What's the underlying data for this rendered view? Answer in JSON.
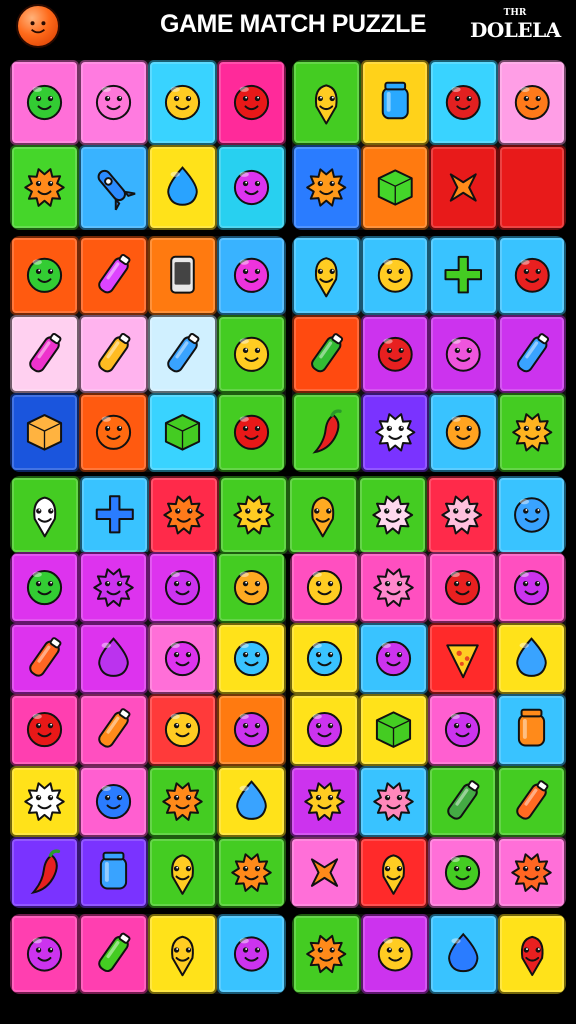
{
  "header": {
    "title": "GAME MATCH PUZZLE",
    "brand_small": "THR",
    "brand_large": "DOLELA",
    "menu_icon": "orange-face-icon"
  },
  "panels": [
    {
      "name": "left-block-1",
      "cols": 4,
      "rows": 2,
      "tiles": [
        {
          "bg": "#ff6fd8",
          "icon": "blob-face",
          "color": "#33cc33"
        },
        {
          "bg": "#ff7be0",
          "icon": "blob-face",
          "color": "#ff77d9"
        },
        {
          "bg": "#39d3ff",
          "icon": "blob-face",
          "color": "#ffcc22"
        },
        {
          "bg": "#ff2a9a",
          "icon": "blob-face",
          "color": "#e81818"
        },
        {
          "bg": "#45d62a",
          "icon": "spiky-face",
          "color": "#ff8a1a"
        },
        {
          "bg": "#39b3ff",
          "icon": "rocket",
          "color": "#2b8bff"
        },
        {
          "bg": "#ffe21a",
          "icon": "drop",
          "color": "#29a3ff"
        },
        {
          "bg": "#28d0f0",
          "icon": "blob-face",
          "color": "#dd33ee"
        }
      ]
    },
    {
      "name": "right-block-1",
      "cols": 4,
      "rows": 2,
      "tiles": [
        {
          "bg": "#44cc22",
          "icon": "cone-face",
          "color": "#ffcc22"
        },
        {
          "bg": "#ffd21a",
          "icon": "jar",
          "color": "#2aa9ff"
        },
        {
          "bg": "#39d3ff",
          "icon": "blob-face",
          "color": "#e32020"
        },
        {
          "bg": "#ff9ee6",
          "icon": "blob-face",
          "color": "#ff7a1a"
        },
        {
          "bg": "#2a7cff",
          "icon": "spiky-face",
          "color": "#ff9a1a"
        },
        {
          "bg": "#ff7a10",
          "icon": "cube",
          "color": "#44d62a"
        },
        {
          "bg": "#e81a1a",
          "icon": "cross",
          "color": "#ff8c1a"
        },
        {
          "bg": "#e81a1a",
          "icon": "none",
          "color": "#ff8c1a"
        }
      ]
    },
    {
      "name": "left-block-2",
      "cols": 4,
      "rows": 3,
      "tiles": [
        {
          "bg": "#ff5a10",
          "icon": "blob-face",
          "color": "#33cc33"
        },
        {
          "bg": "#ff5a10",
          "icon": "bottle",
          "color": "#dd44ff"
        },
        {
          "bg": "#ff7a10",
          "icon": "phone",
          "color": "#444444"
        },
        {
          "bg": "#39b3ff",
          "icon": "blob-face",
          "color": "#ee33dd"
        },
        {
          "bg": "#ffd0f0",
          "icon": "bottle",
          "color": "#ee33cc"
        },
        {
          "bg": "#ffb3ee",
          "icon": "bottle",
          "color": "#ffbb22"
        },
        {
          "bg": "#d0f0ff",
          "icon": "bottle",
          "color": "#39a3ff"
        },
        {
          "bg": "#44cc22",
          "icon": "blob-face",
          "color": "#ffcc22"
        },
        {
          "bg": "#1a55dd",
          "icon": "cube",
          "color": "#ffb340"
        },
        {
          "bg": "#ff5a10",
          "icon": "blob-face",
          "color": "#ff6a10"
        },
        {
          "bg": "#39d3ff",
          "icon": "cube",
          "color": "#44cc22"
        },
        {
          "bg": "#44cc22",
          "icon": "blob-face",
          "color": "#e81818"
        }
      ]
    },
    {
      "name": "right-block-2",
      "cols": 4,
      "rows": 3,
      "tiles": [
        {
          "bg": "#39c3ff",
          "icon": "cone-face",
          "color": "#ffcc22"
        },
        {
          "bg": "#39c3ff",
          "icon": "blob-face",
          "color": "#ffcc22"
        },
        {
          "bg": "#39c3ff",
          "icon": "plus",
          "color": "#44cc22"
        },
        {
          "bg": "#39c3ff",
          "icon": "blob-face",
          "color": "#e82020"
        },
        {
          "bg": "#ff4a10",
          "icon": "bottle",
          "color": "#33bb33"
        },
        {
          "bg": "#cc33ee",
          "icon": "blob-face",
          "color": "#e82020"
        },
        {
          "bg": "#cc33ee",
          "icon": "blob-face",
          "color": "#ee55dd"
        },
        {
          "bg": "#cc33ee",
          "icon": "bottle",
          "color": "#39a3ff"
        },
        {
          "bg": "#44cc22",
          "icon": "pepper",
          "color": "#e82020"
        },
        {
          "bg": "#7a33ff",
          "icon": "spiky-face",
          "color": "#ffffff"
        },
        {
          "bg": "#39c3ff",
          "icon": "blob-face",
          "color": "#ffa320"
        },
        {
          "bg": "#44cc22",
          "icon": "spiky-face",
          "color": "#ffb320"
        }
      ]
    },
    {
      "name": "middle-row",
      "cols": 8,
      "rows": 1,
      "tiles": [
        {
          "bg": "#44cc22",
          "icon": "cone-face",
          "color": "#ffffff"
        },
        {
          "bg": "#39c3ff",
          "icon": "plus",
          "color": "#2a7cff"
        },
        {
          "bg": "#ff2a4a",
          "icon": "spiky-face",
          "color": "#ff7a1a"
        },
        {
          "bg": "#44cc22",
          "icon": "spiky-face",
          "color": "#ffcc22"
        },
        {
          "bg": "#44cc22",
          "icon": "cone-face",
          "color": "#ffaa22"
        },
        {
          "bg": "#44cc22",
          "icon": "spiky-face",
          "color": "#ffd8ee"
        },
        {
          "bg": "#ff2a4a",
          "icon": "spiky-face",
          "color": "#ffc0dd"
        },
        {
          "bg": "#39c3ff",
          "icon": "blob-face",
          "color": "#39a3ff"
        }
      ]
    },
    {
      "name": "left-block-3",
      "cols": 4,
      "rows": 5,
      "tiles": [
        {
          "bg": "#dd33ee",
          "icon": "blob-face",
          "color": "#33cc33"
        },
        {
          "bg": "#dd33ee",
          "icon": "spiky-face",
          "color": "#cc33ee"
        },
        {
          "bg": "#dd33ee",
          "icon": "blob-face",
          "color": "#cc33ee"
        },
        {
          "bg": "#44cc22",
          "icon": "blob-face",
          "color": "#ffaa22"
        },
        {
          "bg": "#dd33ee",
          "icon": "bottle",
          "color": "#ff6622"
        },
        {
          "bg": "#dd33ee",
          "icon": "drop",
          "color": "#bb33ee"
        },
        {
          "bg": "#ff6fd8",
          "icon": "blob-face",
          "color": "#dd33ee"
        },
        {
          "bg": "#ffe21a",
          "icon": "blob-face",
          "color": "#39c3ff"
        },
        {
          "bg": "#ff3fb0",
          "icon": "blob-face",
          "color": "#e81818"
        },
        {
          "bg": "#ff4fc0",
          "icon": "bottle",
          "color": "#ff8a1a"
        },
        {
          "bg": "#ff3a3a",
          "icon": "blob-face",
          "color": "#ffcc22"
        },
        {
          "bg": "#ff7a10",
          "icon": "blob-face",
          "color": "#cc33ee"
        },
        {
          "bg": "#ffe21a",
          "icon": "spiky-face",
          "color": "#ffffff"
        },
        {
          "bg": "#ff5fd0",
          "icon": "blob-face",
          "color": "#2a7cff"
        },
        {
          "bg": "#44cc22",
          "icon": "spiky-face",
          "color": "#ff8a1a"
        },
        {
          "bg": "#ffe21a",
          "icon": "drop",
          "color": "#39a3ff"
        },
        {
          "bg": "#7a33ff",
          "icon": "pepper",
          "color": "#e82020"
        },
        {
          "bg": "#7a33ff",
          "icon": "jar",
          "color": "#39a3ff"
        },
        {
          "bg": "#44cc22",
          "icon": "cone-face",
          "color": "#ffcc22"
        },
        {
          "bg": "#44cc22",
          "icon": "spiky-face",
          "color": "#ff8a1a"
        }
      ]
    },
    {
      "name": "right-block-3",
      "cols": 4,
      "rows": 5,
      "tiles": [
        {
          "bg": "#ff4fc0",
          "icon": "blob-face",
          "color": "#ffcc22"
        },
        {
          "bg": "#ff4fc0",
          "icon": "spiky-face",
          "color": "#ff88cc"
        },
        {
          "bg": "#ff4fc0",
          "icon": "blob-face",
          "color": "#e82020"
        },
        {
          "bg": "#ff4fc0",
          "icon": "blob-face",
          "color": "#cc33ee"
        },
        {
          "bg": "#ffe21a",
          "icon": "blob-face",
          "color": "#39c3ff"
        },
        {
          "bg": "#39c3ff",
          "icon": "blob-face",
          "color": "#cc33ee"
        },
        {
          "bg": "#ff2a2a",
          "icon": "slice",
          "color": "#ffcc22"
        },
        {
          "bg": "#ffe21a",
          "icon": "drop",
          "color": "#39a3ff"
        },
        {
          "bg": "#ffe21a",
          "icon": "blob-face",
          "color": "#cc33ee"
        },
        {
          "bg": "#ffe21a",
          "icon": "cube",
          "color": "#44cc22"
        },
        {
          "bg": "#ff5fd0",
          "icon": "blob-face",
          "color": "#cc33ee"
        },
        {
          "bg": "#39c3ff",
          "icon": "jar",
          "color": "#ff8a1a"
        },
        {
          "bg": "#cc33ee",
          "icon": "spiky-face",
          "color": "#ffcc22"
        },
        {
          "bg": "#39c3ff",
          "icon": "spiky-face",
          "color": "#ff88bb"
        },
        {
          "bg": "#44cc22",
          "icon": "bottle",
          "color": "#44aa44"
        },
        {
          "bg": "#44cc22",
          "icon": "bottle",
          "color": "#ff6a22"
        },
        {
          "bg": "#ff6fd8",
          "icon": "cross",
          "color": "#ff8a1a"
        },
        {
          "bg": "#ff2a2a",
          "icon": "cone-face",
          "color": "#ffcc22"
        },
        {
          "bg": "#ff6fd8",
          "icon": "blob-face",
          "color": "#44cc22"
        },
        {
          "bg": "#ff6fd8",
          "icon": "spiky-face",
          "color": "#ff6622"
        }
      ]
    },
    {
      "name": "left-block-4",
      "cols": 4,
      "rows": 1,
      "tiles": [
        {
          "bg": "#ff3fb0",
          "icon": "blob-face",
          "color": "#cc33ee"
        },
        {
          "bg": "#ff3fb0",
          "icon": "bottle",
          "color": "#44cc22"
        },
        {
          "bg": "#ffe21a",
          "icon": "cone-face",
          "color": "#ffcc22"
        },
        {
          "bg": "#39c3ff",
          "icon": "blob-face",
          "color": "#cc33ee"
        }
      ]
    },
    {
      "name": "right-block-4",
      "cols": 4,
      "rows": 1,
      "tiles": [
        {
          "bg": "#44cc22",
          "icon": "spiky-face",
          "color": "#ff8a1a"
        },
        {
          "bg": "#cc33ee",
          "icon": "blob-face",
          "color": "#ffcc22"
        },
        {
          "bg": "#39c3ff",
          "icon": "drop",
          "color": "#2a7cff"
        },
        {
          "bg": "#ffe21a",
          "icon": "cone-face",
          "color": "#e82020"
        }
      ]
    }
  ]
}
